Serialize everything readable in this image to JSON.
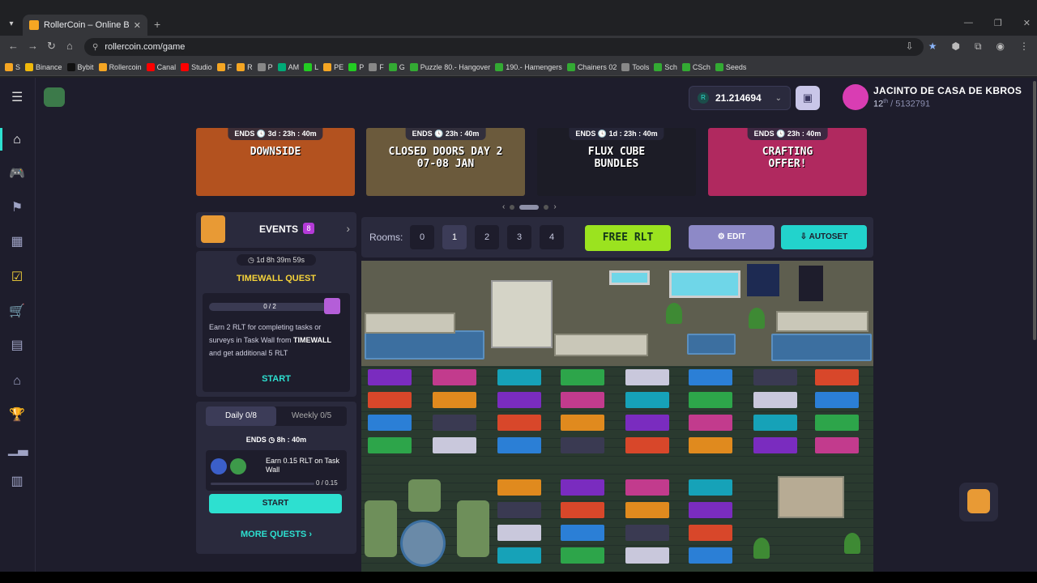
{
  "browser": {
    "tab_title": "RollerCoin – Online Bitcoin Mi",
    "url": "rollercoin.com/game",
    "bookmarks": [
      "S",
      "Binance",
      "Bybit",
      "Rollercoin",
      "Canal",
      "Studio",
      "F",
      "R",
      "P",
      "AM",
      "L",
      "PE",
      "P",
      "F",
      "G",
      "Puzzle 80.- Hangover",
      "190.- Hamengers",
      "Chainers 02",
      "Tools",
      "Sch",
      "CSch",
      "Seeds"
    ]
  },
  "header": {
    "balance": "21.214694",
    "currency_symbol": "R",
    "username": "JACINTO DE CASA DE KBROS",
    "rank_position": "12",
    "rank_suffix": "th",
    "rank_total": "/ 5132791"
  },
  "banners": [
    {
      "ends": "ENDS 🕓 3d : 23h : 40m",
      "title": "DOWNSIDE",
      "bg": "#b3521f"
    },
    {
      "ends": "ENDS 🕓 23h : 40m",
      "title": "CLOSED DOORS DAY 2\n07-08 JAN",
      "bg": "#6b5a3c"
    },
    {
      "ends": "ENDS 🕓 1d : 23h : 40m",
      "title": "FLUX CUBE\nBUNDLES",
      "bg": "#1c1c26"
    },
    {
      "ends": "ENDS 🕓 23h : 40m",
      "title": "CRAFTING\nOFFER!",
      "bg": "#b0295f"
    }
  ],
  "events": {
    "label": "EVENTS",
    "count": "8"
  },
  "quest": {
    "timer": "1d 8h 39m 59s",
    "title": "TIMEWALL QUEST",
    "progress": "0 / 2",
    "desc_1": "Earn 2 RLT for completing tasks or surveys in Task Wall from",
    "desc_brand": "TIMEWALL",
    "desc_2": "and get additional 5 RLT",
    "start": "START"
  },
  "daily": {
    "tab_daily": "Daily  0/8",
    "tab_weekly": "Weekly  0/5",
    "ends_label": "ENDS",
    "ends_time": "8h : 40m",
    "task_title": "Earn 0.15 RLT on Task Wall",
    "task_progress": "0 / 0.15",
    "start": "START",
    "more": "MORE QUESTS"
  },
  "rooms": {
    "label": "Rooms:",
    "numbers": [
      "0",
      "1",
      "2",
      "3",
      "4"
    ],
    "active": "1",
    "free_rlt": "FREE RLT",
    "edit": "EDIT",
    "autoset": "AUTOSET"
  },
  "colors": {
    "accent": "#2de0d0",
    "bg": "#1e1d2c",
    "panel": "#2a2a3d",
    "free_rlt": "#9be31f",
    "edit": "#8d89c7"
  }
}
